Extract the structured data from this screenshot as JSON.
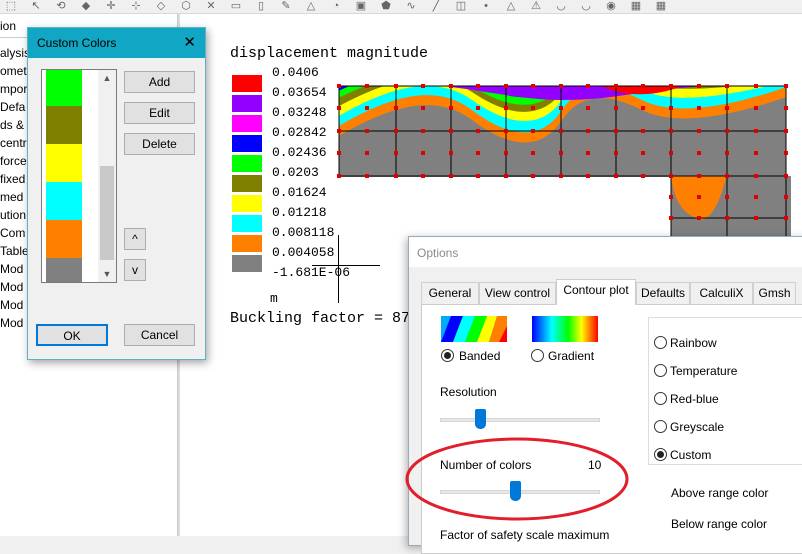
{
  "toolbar": {
    "icons": [
      "cursor-icon",
      "select-icon",
      "rotate-icon",
      "color-icon",
      "move-icon",
      "node-icon",
      "plane-icon",
      "cube-icon",
      "cut-icon",
      "edge-icon",
      "surface-icon",
      "draw-icon",
      "cone-icon",
      "fillet-icon",
      "extrude-icon",
      "shape-icon",
      "curve-icon",
      "line-icon",
      "face-icon",
      "point-icon",
      "triangle-icon",
      "warning-icon",
      "mesh-icon",
      "mesh2-icon",
      "mesh3-icon",
      "film-icon",
      "table-icon"
    ]
  },
  "tree": {
    "tab_label": "ion",
    "items": [
      "alysis",
      "ometr",
      "mpor",
      "Defa",
      "ds &",
      "centr",
      "force",
      "fixed",
      "med S",
      "ution",
      "Com",
      "Table",
      "Mod",
      "Mod",
      "Mod",
      "Mod"
    ]
  },
  "plot": {
    "heading": "displacement magnitude",
    "legend_values": [
      "0.0406",
      "0.03654",
      "0.03248",
      "0.02842",
      "0.02436",
      "0.0203",
      "0.01624",
      "0.01218",
      "0.008118",
      "0.004058",
      "-1.681E-06"
    ],
    "legend_colors": [
      "#ff0000",
      "#9400ff",
      "#ff00ff",
      "#0000ff",
      "#00ff00",
      "#808000",
      "#ffff00",
      "#00ffff",
      "#ff8000",
      "#808080"
    ],
    "unit": "m",
    "buckling_label": "Buckling factor = 87"
  },
  "custom_colors": {
    "title": "Custom Colors",
    "colors": [
      "#00ff00",
      "#808000",
      "#ffff00",
      "#00ffff",
      "#ff8000",
      "#808080"
    ],
    "add_label": "Add",
    "edit_label": "Edit",
    "delete_label": "Delete",
    "up_label": "^",
    "down_label": "v",
    "ok_label": "OK",
    "cancel_label": "Cancel"
  },
  "options": {
    "title": "Options",
    "tabs": [
      "General",
      "View control",
      "Contour plot",
      "Defaults",
      "CalculiX",
      "Gmsh"
    ],
    "active_tab": "Contour plot",
    "mode_banded": "Banded",
    "mode_gradient": "Gradient",
    "selected_mode": "Banded",
    "resolution_label": "Resolution",
    "resolution_level": 0.25,
    "num_colors_label": "Number of colors",
    "num_colors_value": "10",
    "num_colors_level": 0.47,
    "factor_label": "Factor of safety scale maximum",
    "schemes": [
      "Rainbow",
      "Temperature",
      "Red-blue",
      "Greyscale",
      "Custom"
    ],
    "selected_scheme": "Custom",
    "above_range_label": "Above range color",
    "below_range_label": "Below range color"
  }
}
